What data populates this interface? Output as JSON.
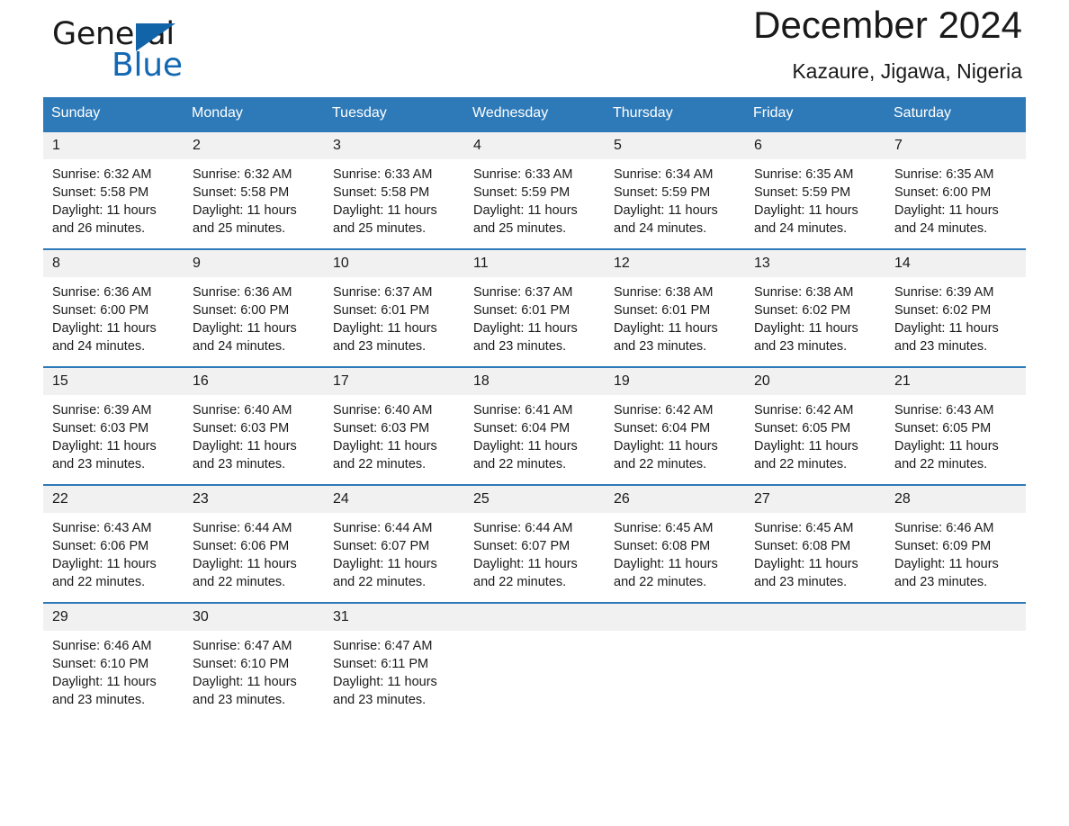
{
  "brand": {
    "word_general": "General",
    "word_blue": "Blue",
    "accent_color": "#1268b3",
    "triangle_icon": "brand-triangle-icon"
  },
  "header": {
    "month_title": "December 2024",
    "location": "Kazaure, Jigawa, Nigeria"
  },
  "calendar": {
    "header_bg": "#2e7ab8",
    "daynum_bg": "#f1f1f1",
    "weekdays": [
      "Sunday",
      "Monday",
      "Tuesday",
      "Wednesday",
      "Thursday",
      "Friday",
      "Saturday"
    ],
    "weeks": [
      [
        {
          "day": "1",
          "sunrise": "Sunrise: 6:32 AM",
          "sunset": "Sunset: 5:58 PM",
          "daylight_l1": "Daylight: 11 hours",
          "daylight_l2": "and 26 minutes."
        },
        {
          "day": "2",
          "sunrise": "Sunrise: 6:32 AM",
          "sunset": "Sunset: 5:58 PM",
          "daylight_l1": "Daylight: 11 hours",
          "daylight_l2": "and 25 minutes."
        },
        {
          "day": "3",
          "sunrise": "Sunrise: 6:33 AM",
          "sunset": "Sunset: 5:58 PM",
          "daylight_l1": "Daylight: 11 hours",
          "daylight_l2": "and 25 minutes."
        },
        {
          "day": "4",
          "sunrise": "Sunrise: 6:33 AM",
          "sunset": "Sunset: 5:59 PM",
          "daylight_l1": "Daylight: 11 hours",
          "daylight_l2": "and 25 minutes."
        },
        {
          "day": "5",
          "sunrise": "Sunrise: 6:34 AM",
          "sunset": "Sunset: 5:59 PM",
          "daylight_l1": "Daylight: 11 hours",
          "daylight_l2": "and 24 minutes."
        },
        {
          "day": "6",
          "sunrise": "Sunrise: 6:35 AM",
          "sunset": "Sunset: 5:59 PM",
          "daylight_l1": "Daylight: 11 hours",
          "daylight_l2": "and 24 minutes."
        },
        {
          "day": "7",
          "sunrise": "Sunrise: 6:35 AM",
          "sunset": "Sunset: 6:00 PM",
          "daylight_l1": "Daylight: 11 hours",
          "daylight_l2": "and 24 minutes."
        }
      ],
      [
        {
          "day": "8",
          "sunrise": "Sunrise: 6:36 AM",
          "sunset": "Sunset: 6:00 PM",
          "daylight_l1": "Daylight: 11 hours",
          "daylight_l2": "and 24 minutes."
        },
        {
          "day": "9",
          "sunrise": "Sunrise: 6:36 AM",
          "sunset": "Sunset: 6:00 PM",
          "daylight_l1": "Daylight: 11 hours",
          "daylight_l2": "and 24 minutes."
        },
        {
          "day": "10",
          "sunrise": "Sunrise: 6:37 AM",
          "sunset": "Sunset: 6:01 PM",
          "daylight_l1": "Daylight: 11 hours",
          "daylight_l2": "and 23 minutes."
        },
        {
          "day": "11",
          "sunrise": "Sunrise: 6:37 AM",
          "sunset": "Sunset: 6:01 PM",
          "daylight_l1": "Daylight: 11 hours",
          "daylight_l2": "and 23 minutes."
        },
        {
          "day": "12",
          "sunrise": "Sunrise: 6:38 AM",
          "sunset": "Sunset: 6:01 PM",
          "daylight_l1": "Daylight: 11 hours",
          "daylight_l2": "and 23 minutes."
        },
        {
          "day": "13",
          "sunrise": "Sunrise: 6:38 AM",
          "sunset": "Sunset: 6:02 PM",
          "daylight_l1": "Daylight: 11 hours",
          "daylight_l2": "and 23 minutes."
        },
        {
          "day": "14",
          "sunrise": "Sunrise: 6:39 AM",
          "sunset": "Sunset: 6:02 PM",
          "daylight_l1": "Daylight: 11 hours",
          "daylight_l2": "and 23 minutes."
        }
      ],
      [
        {
          "day": "15",
          "sunrise": "Sunrise: 6:39 AM",
          "sunset": "Sunset: 6:03 PM",
          "daylight_l1": "Daylight: 11 hours",
          "daylight_l2": "and 23 minutes."
        },
        {
          "day": "16",
          "sunrise": "Sunrise: 6:40 AM",
          "sunset": "Sunset: 6:03 PM",
          "daylight_l1": "Daylight: 11 hours",
          "daylight_l2": "and 23 minutes."
        },
        {
          "day": "17",
          "sunrise": "Sunrise: 6:40 AM",
          "sunset": "Sunset: 6:03 PM",
          "daylight_l1": "Daylight: 11 hours",
          "daylight_l2": "and 22 minutes."
        },
        {
          "day": "18",
          "sunrise": "Sunrise: 6:41 AM",
          "sunset": "Sunset: 6:04 PM",
          "daylight_l1": "Daylight: 11 hours",
          "daylight_l2": "and 22 minutes."
        },
        {
          "day": "19",
          "sunrise": "Sunrise: 6:42 AM",
          "sunset": "Sunset: 6:04 PM",
          "daylight_l1": "Daylight: 11 hours",
          "daylight_l2": "and 22 minutes."
        },
        {
          "day": "20",
          "sunrise": "Sunrise: 6:42 AM",
          "sunset": "Sunset: 6:05 PM",
          "daylight_l1": "Daylight: 11 hours",
          "daylight_l2": "and 22 minutes."
        },
        {
          "day": "21",
          "sunrise": "Sunrise: 6:43 AM",
          "sunset": "Sunset: 6:05 PM",
          "daylight_l1": "Daylight: 11 hours",
          "daylight_l2": "and 22 minutes."
        }
      ],
      [
        {
          "day": "22",
          "sunrise": "Sunrise: 6:43 AM",
          "sunset": "Sunset: 6:06 PM",
          "daylight_l1": "Daylight: 11 hours",
          "daylight_l2": "and 22 minutes."
        },
        {
          "day": "23",
          "sunrise": "Sunrise: 6:44 AM",
          "sunset": "Sunset: 6:06 PM",
          "daylight_l1": "Daylight: 11 hours",
          "daylight_l2": "and 22 minutes."
        },
        {
          "day": "24",
          "sunrise": "Sunrise: 6:44 AM",
          "sunset": "Sunset: 6:07 PM",
          "daylight_l1": "Daylight: 11 hours",
          "daylight_l2": "and 22 minutes."
        },
        {
          "day": "25",
          "sunrise": "Sunrise: 6:44 AM",
          "sunset": "Sunset: 6:07 PM",
          "daylight_l1": "Daylight: 11 hours",
          "daylight_l2": "and 22 minutes."
        },
        {
          "day": "26",
          "sunrise": "Sunrise: 6:45 AM",
          "sunset": "Sunset: 6:08 PM",
          "daylight_l1": "Daylight: 11 hours",
          "daylight_l2": "and 22 minutes."
        },
        {
          "day": "27",
          "sunrise": "Sunrise: 6:45 AM",
          "sunset": "Sunset: 6:08 PM",
          "daylight_l1": "Daylight: 11 hours",
          "daylight_l2": "and 23 minutes."
        },
        {
          "day": "28",
          "sunrise": "Sunrise: 6:46 AM",
          "sunset": "Sunset: 6:09 PM",
          "daylight_l1": "Daylight: 11 hours",
          "daylight_l2": "and 23 minutes."
        }
      ],
      [
        {
          "day": "29",
          "sunrise": "Sunrise: 6:46 AM",
          "sunset": "Sunset: 6:10 PM",
          "daylight_l1": "Daylight: 11 hours",
          "daylight_l2": "and 23 minutes."
        },
        {
          "day": "30",
          "sunrise": "Sunrise: 6:47 AM",
          "sunset": "Sunset: 6:10 PM",
          "daylight_l1": "Daylight: 11 hours",
          "daylight_l2": "and 23 minutes."
        },
        {
          "day": "31",
          "sunrise": "Sunrise: 6:47 AM",
          "sunset": "Sunset: 6:11 PM",
          "daylight_l1": "Daylight: 11 hours",
          "daylight_l2": "and 23 minutes."
        },
        {
          "day": "",
          "sunrise": "",
          "sunset": "",
          "daylight_l1": "",
          "daylight_l2": ""
        },
        {
          "day": "",
          "sunrise": "",
          "sunset": "",
          "daylight_l1": "",
          "daylight_l2": ""
        },
        {
          "day": "",
          "sunrise": "",
          "sunset": "",
          "daylight_l1": "",
          "daylight_l2": ""
        },
        {
          "day": "",
          "sunrise": "",
          "sunset": "",
          "daylight_l1": "",
          "daylight_l2": ""
        }
      ]
    ]
  }
}
